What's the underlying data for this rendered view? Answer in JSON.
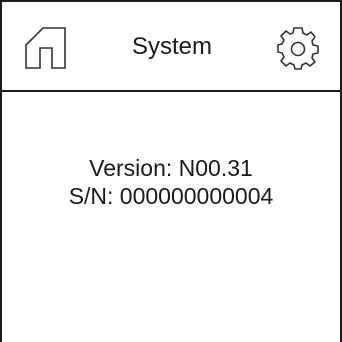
{
  "header": {
    "title": "System",
    "home_icon": "home-icon",
    "settings_icon": "gear-icon"
  },
  "info": {
    "version_text": "Version: N00.31",
    "serial_text": "S/N: 000000000004"
  },
  "colors": {
    "foreground": "#1a1a1a",
    "background": "#ffffff"
  }
}
